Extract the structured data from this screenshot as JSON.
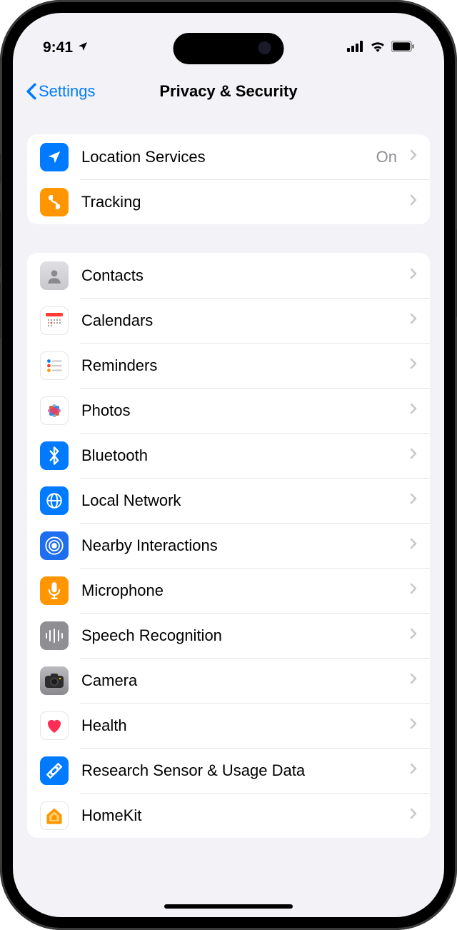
{
  "status": {
    "time": "9:41"
  },
  "nav": {
    "back": "Settings",
    "title": "Privacy & Security"
  },
  "group1": [
    {
      "label": "Location Services",
      "value": "On",
      "icon": "location",
      "bg": "#007aff"
    },
    {
      "label": "Tracking",
      "value": "",
      "icon": "tracking",
      "bg": "#ff9500"
    }
  ],
  "group2": [
    {
      "label": "Contacts",
      "icon": "contacts",
      "bg": "linear-gradient(135deg,#d8d8dc,#c8c8cc)"
    },
    {
      "label": "Calendars",
      "icon": "calendar",
      "bg": "#fff"
    },
    {
      "label": "Reminders",
      "icon": "reminders",
      "bg": "#fff"
    },
    {
      "label": "Photos",
      "icon": "photos",
      "bg": "#fff"
    },
    {
      "label": "Bluetooth",
      "icon": "bluetooth",
      "bg": "#007aff"
    },
    {
      "label": "Local Network",
      "icon": "localnetwork",
      "bg": "#007aff"
    },
    {
      "label": "Nearby Interactions",
      "icon": "nearby",
      "bg": "#1e6ef0"
    },
    {
      "label": "Microphone",
      "icon": "mic",
      "bg": "#ff9500"
    },
    {
      "label": "Speech Recognition",
      "icon": "speech",
      "bg": "#8e8e93"
    },
    {
      "label": "Camera",
      "icon": "camera",
      "bg": "linear-gradient(#b9b9bd,#8a8a8e)"
    },
    {
      "label": "Health",
      "icon": "health",
      "bg": "#fff"
    },
    {
      "label": "Research Sensor & Usage Data",
      "icon": "research",
      "bg": "#007aff"
    },
    {
      "label": "HomeKit",
      "icon": "homekit",
      "bg": "#fff"
    }
  ]
}
